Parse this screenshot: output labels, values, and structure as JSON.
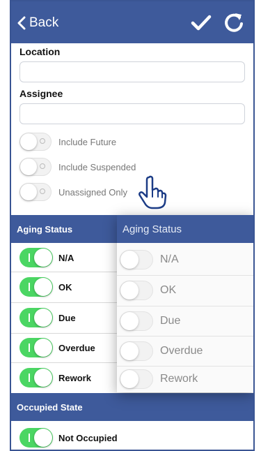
{
  "header": {
    "back_label": "Back"
  },
  "form": {
    "location_label": "Location",
    "location_value": "",
    "assignee_label": "Assignee",
    "assignee_value": ""
  },
  "toggles": [
    {
      "label": "Include Future",
      "on": false
    },
    {
      "label": "Include Suspended",
      "on": false
    },
    {
      "label": "Unassigned Only",
      "on": false
    }
  ],
  "aging": {
    "title": "Aging Status",
    "items": [
      {
        "label": "N/A",
        "on": true
      },
      {
        "label": "OK",
        "on": true
      },
      {
        "label": "Due",
        "on": true
      },
      {
        "label": "Overdue",
        "on": true
      },
      {
        "label": "Rework",
        "on": true
      }
    ]
  },
  "occupied": {
    "title": "Occupied State",
    "items": [
      {
        "label": "Not Occupied",
        "on": true
      }
    ]
  },
  "overlay": {
    "title": "Aging Status",
    "items": [
      {
        "label": "N/A",
        "on": false
      },
      {
        "label": "OK",
        "on": false
      },
      {
        "label": "Due",
        "on": false
      },
      {
        "label": "Overdue",
        "on": false
      },
      {
        "label": "Rework",
        "on": false
      }
    ]
  },
  "colors": {
    "header_bg": "#3e5a9b",
    "toggle_on": "#4bd663"
  },
  "icons": [
    "chevron-left-icon",
    "checkmark-icon",
    "refresh-icon",
    "pointing-hand-icon"
  ]
}
